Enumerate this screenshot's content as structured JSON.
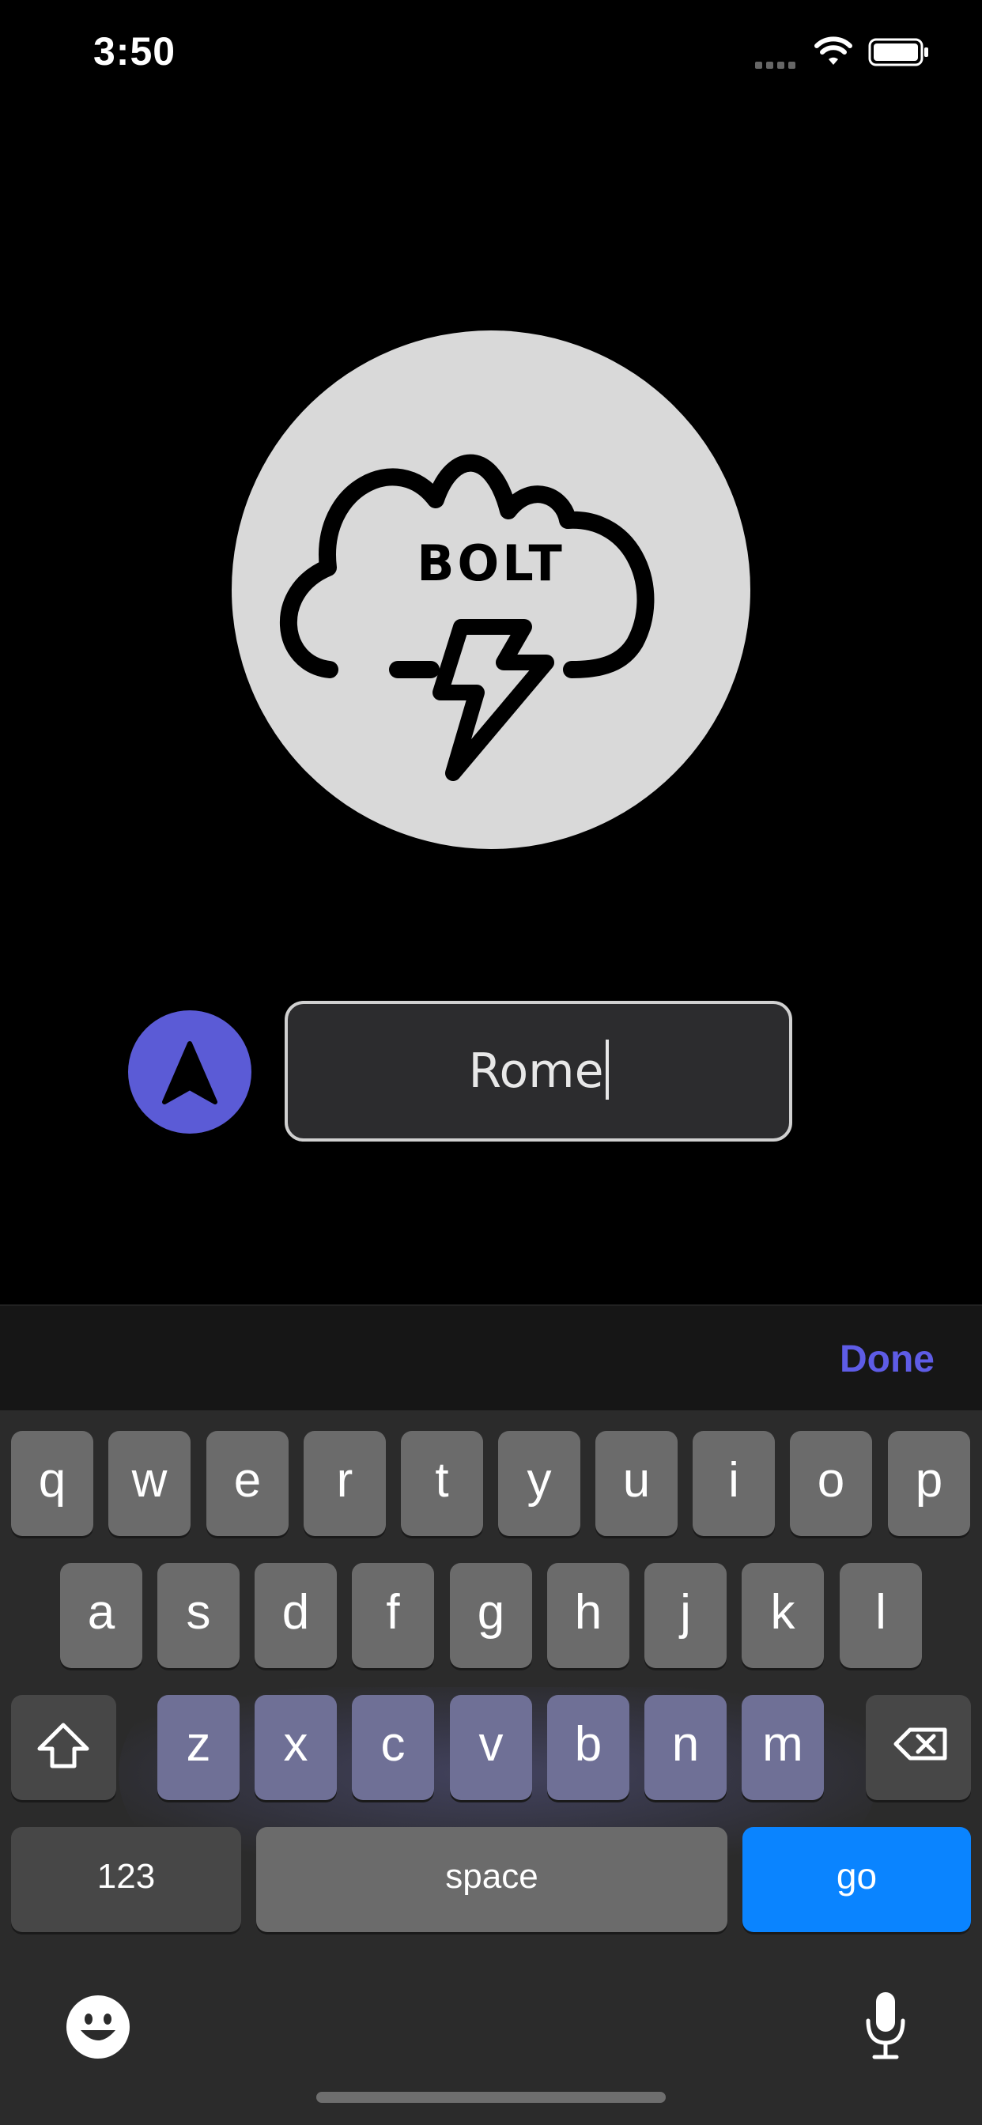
{
  "status_bar": {
    "time": "3:50",
    "signal_icon": "cellular-signal-icon",
    "wifi_icon": "wifi-icon",
    "battery_icon": "battery-icon"
  },
  "logo": {
    "text": "BOLT",
    "icon": "cloud-lightning-icon",
    "circle_color": "#d9d9d9"
  },
  "location_button": {
    "icon": "navigation-arrow-icon",
    "color": "#5b5bd6"
  },
  "city_input": {
    "value": "Rome"
  },
  "accessory_bar": {
    "done_label": "Done",
    "done_color": "#5e5ce6"
  },
  "keyboard": {
    "row1": [
      "q",
      "w",
      "e",
      "r",
      "t",
      "y",
      "u",
      "i",
      "o",
      "p"
    ],
    "row2": [
      "a",
      "s",
      "d",
      "f",
      "g",
      "h",
      "j",
      "k",
      "l"
    ],
    "row3": [
      "z",
      "x",
      "c",
      "v",
      "b",
      "n",
      "m"
    ],
    "shift_icon": "shift-arrow-icon",
    "delete_icon": "delete-backspace-icon",
    "numbers_label": "123",
    "space_label": "space",
    "go_label": "go",
    "go_color": "#0a84ff",
    "emoji_icon": "emoji-icon",
    "mic_icon": "microphone-icon"
  }
}
